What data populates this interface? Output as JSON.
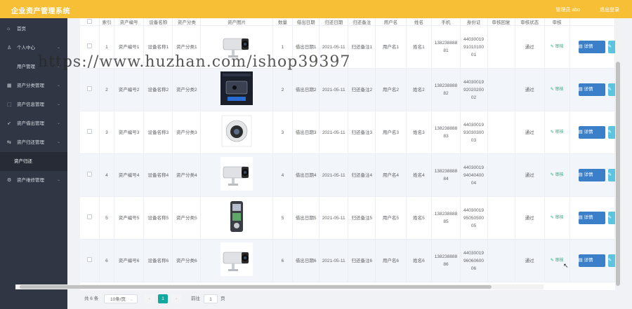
{
  "header": {
    "title": "企业资产管理系统",
    "user": "管理员 abo",
    "logout": "退出登录"
  },
  "sidebar": {
    "items": [
      {
        "label": "首页",
        "icon": "home-icon",
        "glyph": "⌂",
        "arrow": ""
      },
      {
        "label": "个人中心",
        "icon": "user-icon",
        "glyph": "♙",
        "arrow": "⌄"
      },
      {
        "label": "用户管理",
        "icon": "users-icon",
        "glyph": "",
        "arrow": "⌄"
      },
      {
        "label": "资产分类管理",
        "icon": "grid-icon",
        "glyph": "▦",
        "arrow": "⌄"
      },
      {
        "label": "资产信息管理",
        "icon": "box-icon",
        "glyph": "⬚",
        "arrow": "⌄"
      },
      {
        "label": "资产借出管理",
        "icon": "send-icon",
        "glyph": "➶",
        "arrow": "⌄"
      },
      {
        "label": "资产归还管理",
        "icon": "return-icon",
        "glyph": "⇆",
        "arrow": "⌄"
      },
      {
        "label": "资产归还",
        "icon": "",
        "glyph": "",
        "arrow": "",
        "sub": true
      },
      {
        "label": "资产维修管理",
        "icon": "wrench-icon",
        "glyph": "⚙",
        "arrow": "⌄"
      }
    ]
  },
  "table": {
    "columns": [
      "",
      "索引",
      "资产编号",
      "设备名称",
      "资产分类",
      "资产图片",
      "数量",
      "借出日期",
      "归还日期",
      "归还备注",
      "用户名",
      "姓名",
      "手机",
      "身份证",
      "审核回复",
      "审核状态",
      "审核",
      ""
    ],
    "audit_label": "审核",
    "detail_label": "详情",
    "rows": [
      {
        "idx": "1",
        "code": "资产编号1",
        "name": "设备名称1",
        "cat": "资产分类1",
        "img": "bullet-camera",
        "qty": "1",
        "lend": "借出日期1",
        "ret": "2021-05-11",
        "note": "归还备注1",
        "user": "用户名1",
        "real": "姓名1",
        "phone": "13823888881",
        "id": "440300199101010001",
        "reply": "",
        "status": "通过"
      },
      {
        "idx": "2",
        "code": "资产编号2",
        "name": "设备名称2",
        "cat": "资产分类2",
        "img": "dark-device",
        "qty": "2",
        "lend": "借出日期2",
        "ret": "2021-05-11",
        "note": "归还备注2",
        "user": "用户名2",
        "real": "姓名2",
        "phone": "13823888882",
        "id": "440300199202020002",
        "reply": "",
        "status": "通过"
      },
      {
        "idx": "3",
        "code": "资产编号3",
        "name": "设备名称3",
        "cat": "资产分类3",
        "img": "dome-camera",
        "qty": "3",
        "lend": "借出日期3",
        "ret": "2021-05-11",
        "note": "归还备注3",
        "user": "用户名3",
        "real": "姓名3",
        "phone": "13823888883",
        "id": "440300199303030003",
        "reply": "",
        "status": "通过"
      },
      {
        "idx": "4",
        "code": "资产编号4",
        "name": "设备名称4",
        "cat": "资产分类4",
        "img": "bullet-camera",
        "qty": "4",
        "lend": "借出日期4",
        "ret": "2021-05-11",
        "note": "归还备注4",
        "user": "用户名4",
        "real": "姓名4",
        "phone": "13823888884",
        "id": "440300199404040004",
        "reply": "",
        "status": "通过"
      },
      {
        "idx": "5",
        "code": "资产编号5",
        "name": "设备名称5",
        "cat": "资产分类5",
        "img": "recorder",
        "qty": "5",
        "lend": "借出日期5",
        "ret": "2021-05-11",
        "note": "归还备注5",
        "user": "用户名5",
        "real": "姓名5",
        "phone": "13823888885",
        "id": "440300199505050005",
        "reply": "",
        "status": "通过"
      },
      {
        "idx": "6",
        "code": "资产编号6",
        "name": "设备名称6",
        "cat": "资产分类6",
        "img": "bullet-camera",
        "qty": "6",
        "lend": "借出日期6",
        "ret": "2021-05-11",
        "note": "归还备注6",
        "user": "用户名6",
        "real": "姓名6",
        "phone": "13823888886",
        "id": "440300199606060006",
        "reply": "",
        "status": "通过"
      }
    ]
  },
  "pagination": {
    "total": "共 6 条",
    "page_size": "10条/页",
    "prev": "‹",
    "current": "1",
    "next": "›",
    "goto_label": "前往",
    "goto_value": "1",
    "page_suffix": "页"
  },
  "watermark": "https://www.huzhan.com/ishop39397"
}
